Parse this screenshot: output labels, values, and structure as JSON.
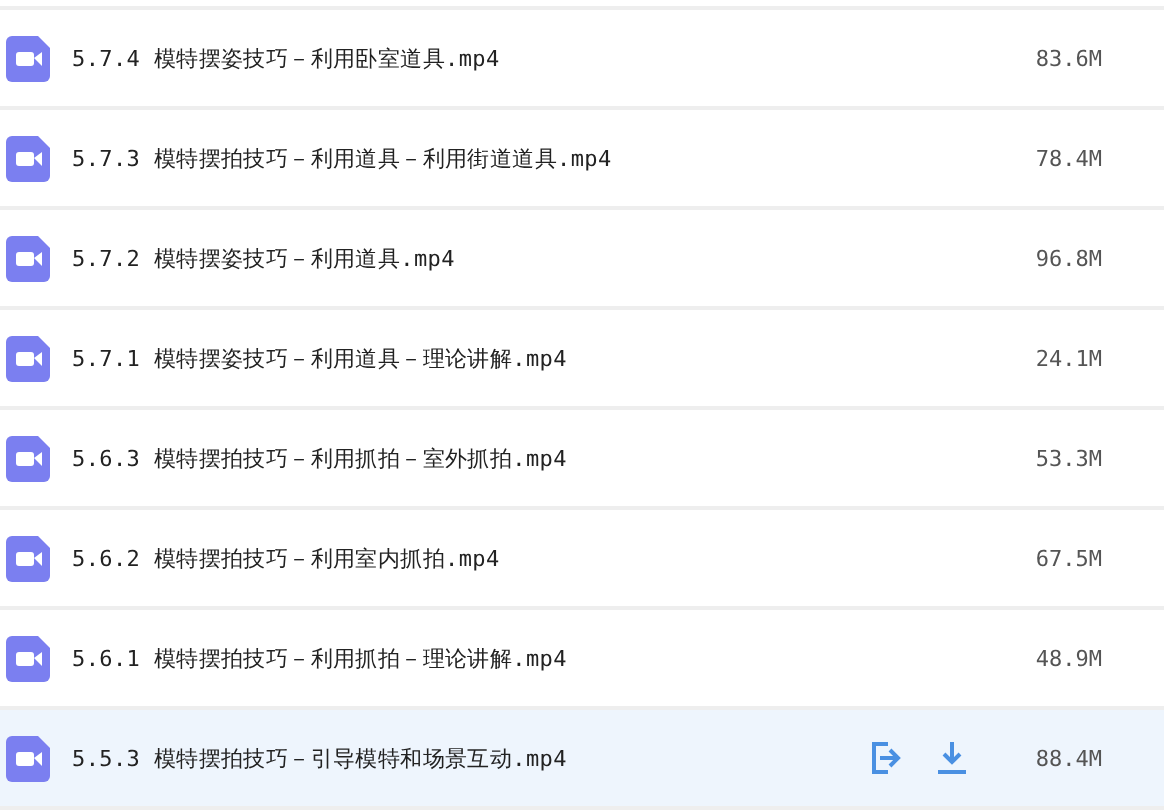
{
  "files": [
    {
      "name": "5.7.4 模特摆姿技巧－利用卧室道具.mp4",
      "size": "83.6M",
      "selected": false
    },
    {
      "name": "5.7.3 模特摆拍技巧－利用道具－利用街道道具.mp4",
      "size": "78.4M",
      "selected": false
    },
    {
      "name": "5.7.2 模特摆姿技巧－利用道具.mp4",
      "size": "96.8M",
      "selected": false
    },
    {
      "name": "5.7.1 模特摆姿技巧－利用道具－理论讲解.mp4",
      "size": "24.1M",
      "selected": false
    },
    {
      "name": "5.6.3 模特摆拍技巧－利用抓拍－室外抓拍.mp4",
      "size": "53.3M",
      "selected": false
    },
    {
      "name": "5.6.2 模特摆拍技巧－利用室内抓拍.mp4",
      "size": "67.5M",
      "selected": false
    },
    {
      "name": "5.6.1 模特摆拍技巧－利用抓拍－理论讲解.mp4",
      "size": "48.9M",
      "selected": false
    },
    {
      "name": "5.5.3 模特摆拍技巧－引导模特和场景互动.mp4",
      "size": "88.4M",
      "selected": true
    }
  ]
}
